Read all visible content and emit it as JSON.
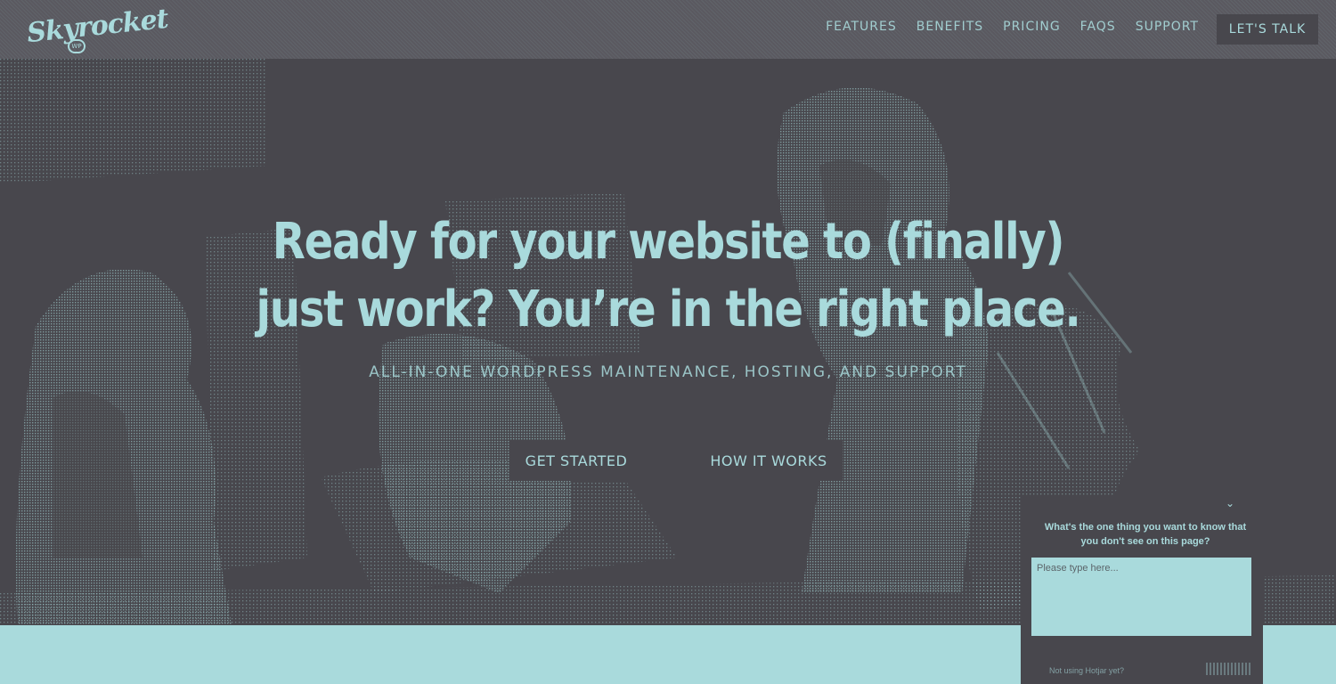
{
  "brand": {
    "logo_text": "Skyrocket",
    "badge": "WP"
  },
  "nav": {
    "items": [
      "FEATURES",
      "BENEFITS",
      "PRICING",
      "FAQS",
      "SUPPORT"
    ],
    "cta": "LET'S TALK"
  },
  "hero": {
    "headline": "Ready for your website to (finally) just work? You’re in the right place.",
    "subheadline": "ALL-IN-ONE WORDPRESS MAINTENANCE, HOSTING, AND SUPPORT",
    "primary_button": "GET STARTED",
    "secondary_button": "HOW IT WORKS"
  },
  "feedback": {
    "close_icon": "chevron-down-icon",
    "close_glyph": "⌄",
    "question": "What's the one thing you want to know that you don't see on this page?",
    "placeholder": "Please type here...",
    "footer": "Not using Hotjar yet?"
  },
  "colors": {
    "accent": "#a9dadc",
    "dark": "#48474d",
    "header": "#5a5960"
  }
}
